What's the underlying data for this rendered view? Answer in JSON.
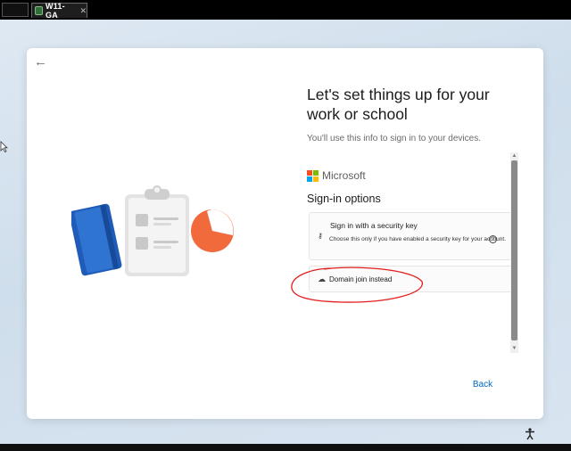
{
  "vm_tab": {
    "title": "W11-GA",
    "close": "✕"
  },
  "page": {
    "heading": "Let's set things up for your work or school",
    "subheading": "You'll use this info to sign in to your devices.",
    "brand": "Microsoft",
    "signin_title": "Sign-in options",
    "options": [
      {
        "title": "Sign in with a security key",
        "description": "Choose this only if you have enabled a security key for your account.",
        "icon": "key-icon",
        "help_glyph": "?"
      },
      {
        "title": "Domain join instead",
        "icon": "domain-join-icon"
      }
    ],
    "back_label": "Back"
  },
  "colors": {
    "accent": "#0067c0",
    "annotation": "#e21d1d",
    "ms_red": "#f25022",
    "ms_green": "#7fba00",
    "ms_blue": "#00a4ef",
    "ms_yellow": "#ffb900"
  },
  "icons": {
    "back": "←",
    "key": "⚷",
    "domain": "☁",
    "accessibility": "♿",
    "scroll_up": "▲",
    "scroll_down": "▼"
  }
}
